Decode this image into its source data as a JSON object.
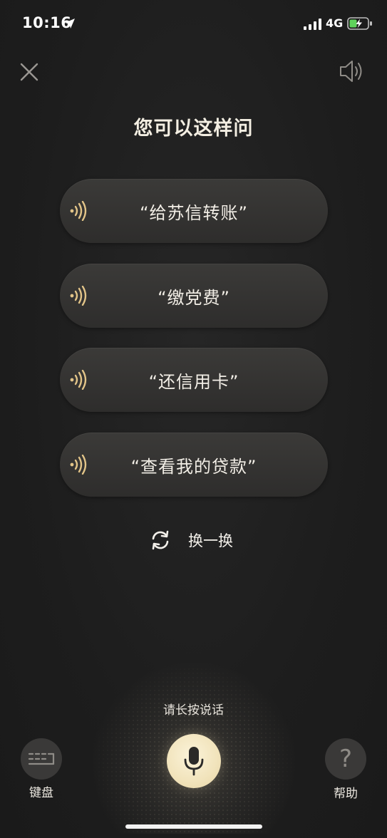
{
  "status_bar": {
    "time": "10:16",
    "network": "4G"
  },
  "title": "您可以这样问",
  "suggestions": [
    {
      "text": "“给苏信转账”"
    },
    {
      "text": "“缴党费”"
    },
    {
      "text": "“还信用卡”"
    },
    {
      "text": "“查看我的贷款”"
    }
  ],
  "refresh_label": "换一换",
  "hint": "请长按说话",
  "keyboard_label": "键盘",
  "help_label": "帮助",
  "help_symbol": "?",
  "colors": {
    "background": "#1f1f1f",
    "accent_gold": "#e2c488",
    "mic_button": "#f1e3bb",
    "pill": "#353432"
  },
  "icons": {
    "close": "close-icon",
    "speaker": "speaker-icon",
    "voice_wave": "voice-wave-icon",
    "refresh": "refresh-icon",
    "microphone": "microphone-icon",
    "keyboard": "keyboard-icon",
    "help": "question-mark-icon"
  }
}
